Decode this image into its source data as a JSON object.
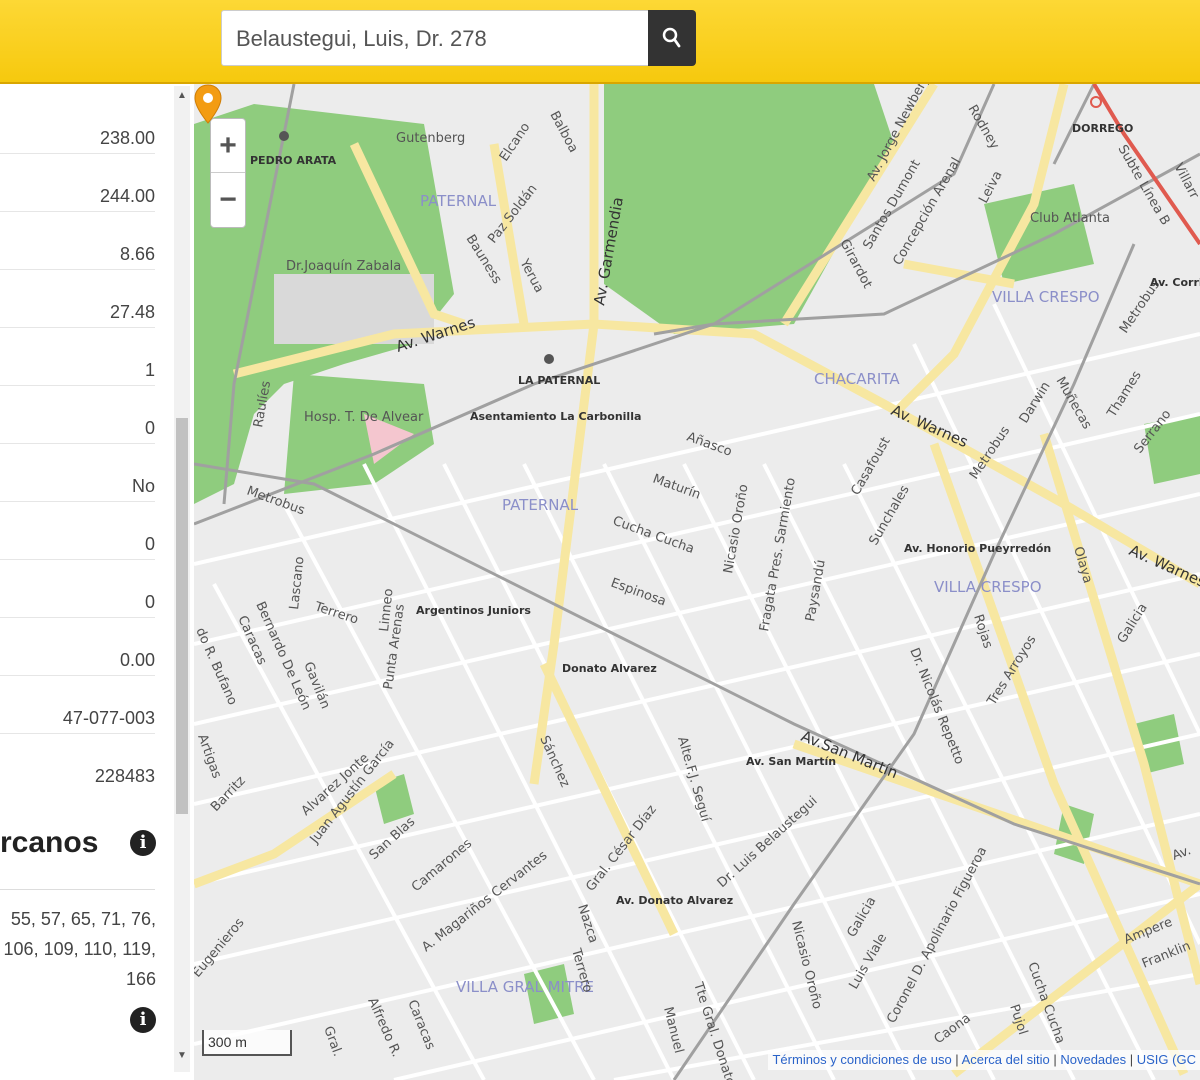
{
  "search": {
    "value": "Belaustegui, Luis, Dr. 278",
    "button_icon": "search-icon"
  },
  "sidebar": {
    "values": [
      "238.00",
      "244.00",
      "8.66",
      "27.48",
      "1",
      "0",
      "No",
      "0",
      "0",
      "0.00",
      "47-077-003",
      "228483"
    ],
    "section_title": "rcanos",
    "lines": "55, 57, 65, 71, 76, 106, 109, 110, 119, 166"
  },
  "map": {
    "zoom_in": "+",
    "zoom_out": "−",
    "scale": "300 m",
    "attribution": {
      "terms": "Términos y condiciones de uso",
      "about": "Acerca del sitio",
      "news": "Novedades",
      "usig": "USIG",
      "gc": "(GC"
    },
    "districts": [
      "PATERNAL",
      "PATERNAL",
      "CHACARITA",
      "VILLA CRESPO",
      "VILLA CRESPO",
      "VILLA GRAL MITRE"
    ],
    "stations": [
      "PEDRO ARATA",
      "LA PATERNAL",
      "DORREGO",
      "Club Atlanta",
      "Asentamiento La Carbonilla",
      "Argentinos Juniors",
      "Donato Alvarez",
      "Av. San Martín",
      "Av. Honorio Pueyrredón",
      "Av. Donato Alvarez",
      "Dr.Joaquín Zabala",
      "Hosp. T. De Alvear",
      "Gutenberg"
    ],
    "streets": [
      "Av. Warnes",
      "Av. Warnes",
      "Av. Warnes",
      "Av. Garmendia",
      "Av.San Martín",
      "Av. Jorge Newbery",
      "Elcano",
      "Balboa",
      "Paz Soldán",
      "Bauness",
      "Yerua",
      "Santos Dumont",
      "Concepción Arenal",
      "Girardot",
      "Leiva",
      "Rodney",
      "Añasco",
      "Maturín",
      "Cucha Cucha",
      "Espinosa",
      "Nicasio Oroño",
      "Fragata Pres. Sarmiento",
      "Paysandú",
      "Casafoust",
      "Sunchales",
      "Darwin",
      "Muñecas",
      "Thames",
      "Serrano",
      "Olaya",
      "Galicia",
      "Rojas",
      "Tres Arroyos",
      "Dr. Nicolás Repetto",
      "Terrero",
      "Linneo",
      "Punta Arenas",
      "Lascano",
      "Bernardo De León",
      "Caracas",
      "Gavilán",
      "Alvarez Jonte",
      "Juan Agustín García",
      "San Blas",
      "Barritz",
      "Artigas",
      "Camarones",
      "A. Magariños Cervantes",
      "Sánchez",
      "Alte.F.J. Seguí",
      "Gral. César Díaz",
      "Dr. Luis Belaustegui",
      "Nicasio Oroño",
      "Galicia",
      "Luis Viale",
      "Coronel D. Apolinario Figueroa",
      "Cucha Cucha",
      "Caona",
      "Pujol",
      "Ampere",
      "Franklin",
      "Alfredo R.",
      "Caracas",
      "Nazca",
      "Terrero",
      "Gral.",
      "Manuel",
      "Tte Gral. Donato",
      "Metrobus",
      "Metrobus",
      "Metrobus",
      "Raulíes",
      "Subte Línea B",
      "Villarr",
      "Av. Corrie",
      "Eugenieros",
      "do R. Bufano",
      "Av."
    ]
  },
  "colors": {
    "header": "#f6c90e",
    "park": "#8fcc7e",
    "road_major": "#f7e7a1",
    "rail": "#999999",
    "subte": "#e05a4f",
    "pin": "#f39c12"
  }
}
